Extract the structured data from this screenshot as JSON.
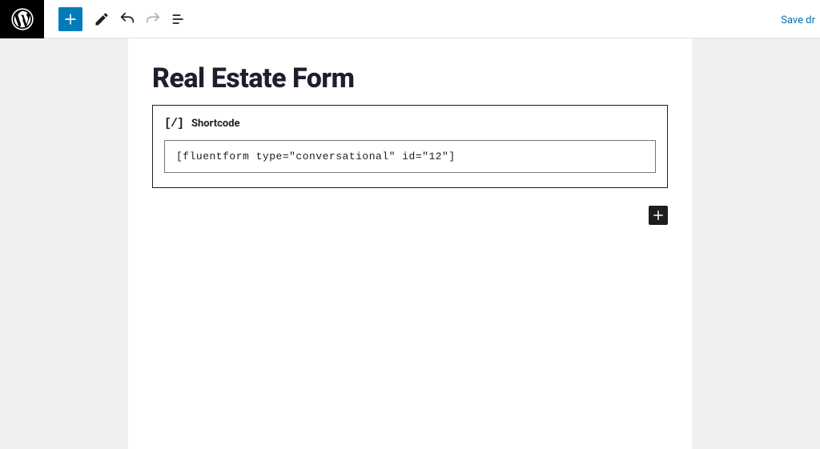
{
  "header": {
    "save_label": "Save dr"
  },
  "post": {
    "title": "Real Estate Form"
  },
  "block": {
    "label": "Shortcode",
    "icon_text": "[/]",
    "value": "[fluentform type=\"conversational\" id=\"12\"]"
  }
}
